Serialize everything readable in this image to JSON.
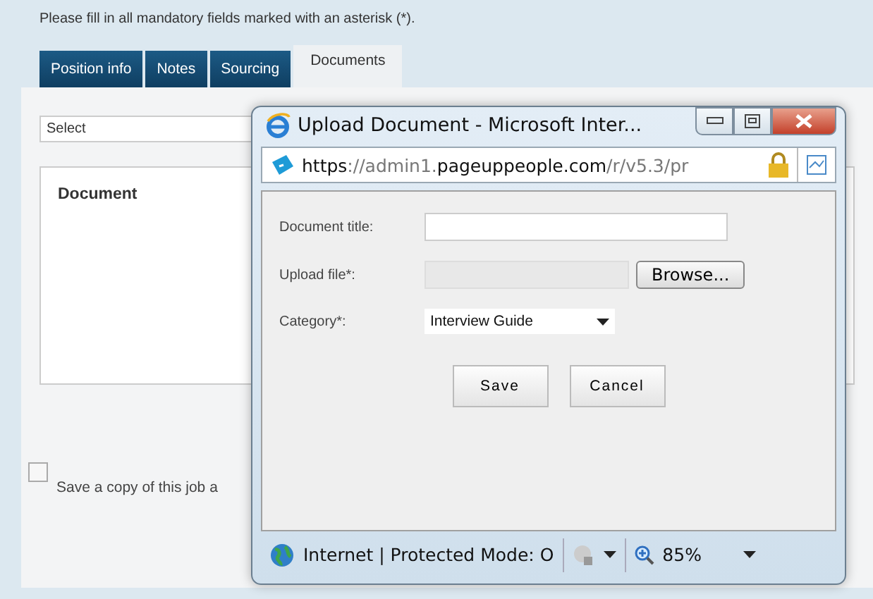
{
  "instruction": "Please fill in all mandatory fields marked with an asterisk (*).",
  "tabs": [
    {
      "label": "Position info",
      "selected": false
    },
    {
      "label": "Notes",
      "selected": false
    },
    {
      "label": "Sourcing",
      "selected": false
    },
    {
      "label": "Documents",
      "selected": true
    }
  ],
  "select": {
    "value": "Select"
  },
  "document_panel": {
    "heading": "Document"
  },
  "save_copy": {
    "label": "Save a copy of this job a",
    "checked": false
  },
  "popup": {
    "title": "Upload Document - Microsoft Inter...",
    "url_parts": [
      {
        "text": "https",
        "strong": true
      },
      {
        "text": "://admin1.",
        "strong": false
      },
      {
        "text": "pageuppeople.com",
        "strong": true
      },
      {
        "text": "/r/v5.3/pr",
        "strong": false
      }
    ],
    "fields": [
      {
        "kind": "text",
        "label": "Document title:"
      },
      {
        "kind": "file",
        "label": "Upload file*:",
        "button": "Browse..."
      },
      {
        "kind": "select",
        "label": "Category*:",
        "value": "Interview Guide"
      }
    ],
    "buttons": [
      "Save",
      "Cancel"
    ],
    "status": {
      "zone": "Internet | Protected Mode: O",
      "zoom": "85%"
    }
  }
}
